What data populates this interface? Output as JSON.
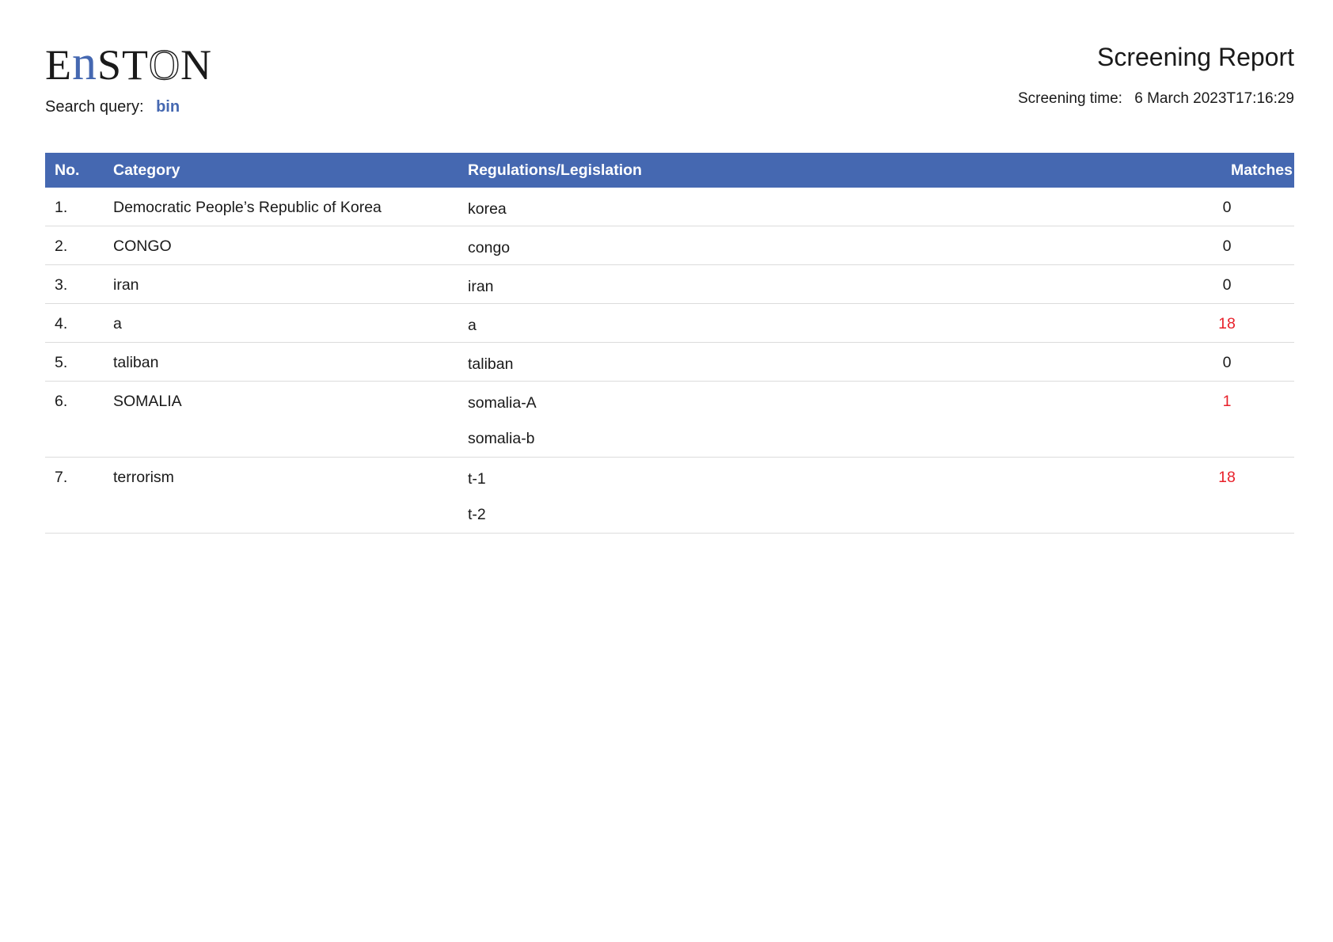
{
  "header": {
    "logo_text": "EnSTON",
    "report_title": "Screening Report",
    "search_query_label": "Search query:",
    "search_query_value": "bin",
    "screening_time_label": "Screening time:",
    "screening_time_value": "6 March 2023T17:16:29"
  },
  "colors": {
    "accent": "#4568b1",
    "match_hit": "#e8202a",
    "header_text": "#ffffff"
  },
  "table": {
    "columns": {
      "no": "No.",
      "category": "Category",
      "regulations": "Regulations/Legislation",
      "matches": "Matches"
    },
    "rows": [
      {
        "no": "1.",
        "category": "Democratic People’s Republic of Korea",
        "regulations": [
          "korea"
        ],
        "matches": "0",
        "highlight": false
      },
      {
        "no": "2.",
        "category": "CONGO",
        "regulations": [
          "congo"
        ],
        "matches": "0",
        "highlight": false
      },
      {
        "no": "3.",
        "category": "iran",
        "regulations": [
          "iran"
        ],
        "matches": "0",
        "highlight": false
      },
      {
        "no": "4.",
        "category": "a",
        "regulations": [
          "a"
        ],
        "matches": "18",
        "highlight": true
      },
      {
        "no": "5.",
        "category": "taliban",
        "regulations": [
          "taliban"
        ],
        "matches": "0",
        "highlight": false
      },
      {
        "no": "6.",
        "category": "SOMALIA",
        "regulations": [
          "somalia-A",
          "somalia-b"
        ],
        "matches": "1",
        "highlight": true
      },
      {
        "no": "7.",
        "category": "terrorism",
        "regulations": [
          "t-1",
          "t-2"
        ],
        "matches": "18",
        "highlight": true
      }
    ]
  }
}
